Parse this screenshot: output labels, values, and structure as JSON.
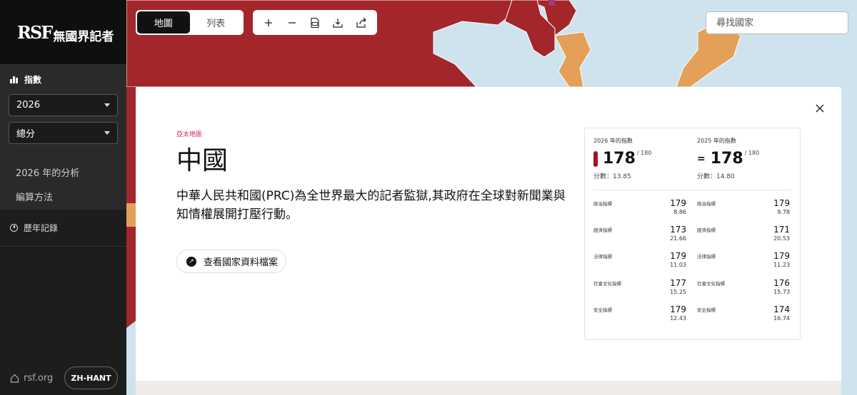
{
  "sidebar": {
    "logo_mark": "RSF",
    "logo_name": "無國界記者",
    "index_label": "指數",
    "year_select": "2026",
    "score_select": "總分",
    "analysis_link": "2026 年的分析",
    "method_link": "編算方法",
    "history_label": "歷年記錄",
    "rsf_link": "rsf.org",
    "lang_button": "ZH-HANT"
  },
  "toolbar": {
    "view_map": "地圖",
    "view_list": "列表",
    "zoom_in_icon": "plus-icon",
    "zoom_out_icon": "minus-icon",
    "pdf_icon": "pdf-icon",
    "download_icon": "download-icon",
    "share_icon": "share-icon"
  },
  "search": {
    "placeholder": "尋找國家"
  },
  "panel": {
    "region": "亞太地區",
    "country": "中國",
    "description": "中華人民共和國(PRC)為全世界最大的記者監獄,其政府在全球對新聞業與知情權展開打壓行動。",
    "profile_button": "查看國家資料檔案"
  },
  "scores": {
    "current": {
      "year_label": "2026 年的指數",
      "rank": "178",
      "total": "/ 180",
      "score": "分數：13.85",
      "indicators": [
        {
          "label": "政治指標",
          "rank": "179",
          "score": "8.86"
        },
        {
          "label": "經濟指標",
          "rank": "173",
          "score": "21.66"
        },
        {
          "label": "法律指標",
          "rank": "179",
          "score": "11.03"
        },
        {
          "label": "社會文化指標",
          "rank": "177",
          "score": "15.25"
        },
        {
          "label": "安全指標",
          "rank": "179",
          "score": "12.43"
        }
      ]
    },
    "previous": {
      "year_label": "2025 年的指數",
      "change_symbol": "=",
      "rank": "178",
      "total": "/ 180",
      "score": "分數：14.80",
      "indicators": [
        {
          "label": "政治指標",
          "rank": "179",
          "score": "9.78"
        },
        {
          "label": "經濟指標",
          "rank": "171",
          "score": "20.53"
        },
        {
          "label": "法律指標",
          "rank": "179",
          "score": "11.23"
        },
        {
          "label": "社會文化指標",
          "rank": "176",
          "score": "15.73"
        },
        {
          "label": "安全指標",
          "rank": "174",
          "score": "16.74"
        }
      ]
    }
  },
  "colors": {
    "very_serious": "#a3262a",
    "difficult": "#e4a059",
    "sea": "#cfe3ef",
    "accent": "#d4145a"
  }
}
